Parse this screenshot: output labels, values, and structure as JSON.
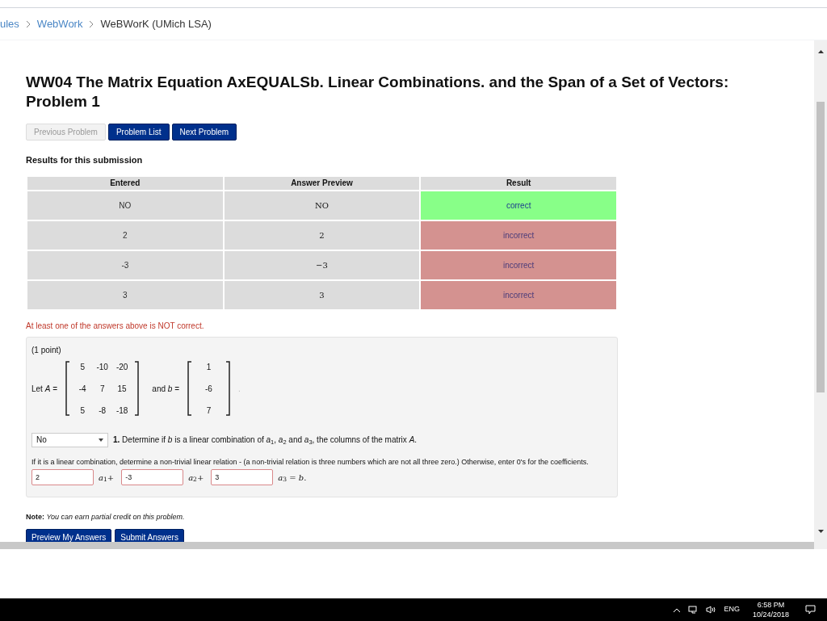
{
  "breadcrumbs": [
    {
      "label": "ules",
      "link": true
    },
    {
      "label": "WebWork",
      "link": true
    },
    {
      "label": "WeBWorK (UMich LSA)",
      "link": false
    }
  ],
  "title": "WW04 The Matrix Equation AxEQUALSb. Linear Combinations. and the Span of a Set of Vectors: Problem 1",
  "nav_buttons": [
    {
      "label": "Previous Problem",
      "disabled": true
    },
    {
      "label": "Problem List",
      "disabled": false
    },
    {
      "label": "Next Problem",
      "disabled": false
    }
  ],
  "results": {
    "heading": "Results for this submission",
    "columns": [
      "Entered",
      "Answer Preview",
      "Result"
    ],
    "rows": [
      {
        "entered": "NO",
        "preview": "NO",
        "result": "correct",
        "correct": true
      },
      {
        "entered": "2",
        "preview": "2",
        "result": "incorrect",
        "correct": false
      },
      {
        "entered": "-3",
        "preview": "−3",
        "result": "incorrect",
        "correct": false
      },
      {
        "entered": "3",
        "preview": "3",
        "result": "incorrect",
        "correct": false
      }
    ]
  },
  "message": "At least one of the answers above is NOT correct.",
  "problem": {
    "points": "(1 point)",
    "let": "Let *A* =",
    "matrix_a": [
      [
        "5",
        "-10",
        "-20"
      ],
      [
        "-4",
        "7",
        "15"
      ],
      [
        "5",
        "-8",
        "-18"
      ]
    ],
    "and": "and *b* =",
    "vector_b": [
      "1",
      "-6",
      "7"
    ],
    "period": ".",
    "select": {
      "value": "No"
    },
    "question": "**1.** Determine if *b* is a linear combination of *a*$_{1}$, *a*$_{2}$ and *a*$_{3}$, the columns of the matrix *A*.",
    "instruction": "If it is a linear combination, determine a non-trivial linear relation - (a non-trivial relation is three numbers which are not all three zero.) Otherwise, enter 0's for the coefficients.",
    "answers": [
      {
        "value": "2",
        "suffix": "*a*$_{1}$+"
      },
      {
        "value": "-3",
        "suffix": "*a*$_{2}$+"
      },
      {
        "value": "3",
        "suffix": "*a*$_{3}$ = *b*."
      }
    ]
  },
  "note": {
    "label": "Note:",
    "text": "You can earn partial credit on this problem."
  },
  "action_buttons": [
    "Preview My Answers",
    "Submit Answers"
  ],
  "taskbar": {
    "language": "ENG",
    "time": "6:58 PM",
    "date": "10/24/2018"
  }
}
